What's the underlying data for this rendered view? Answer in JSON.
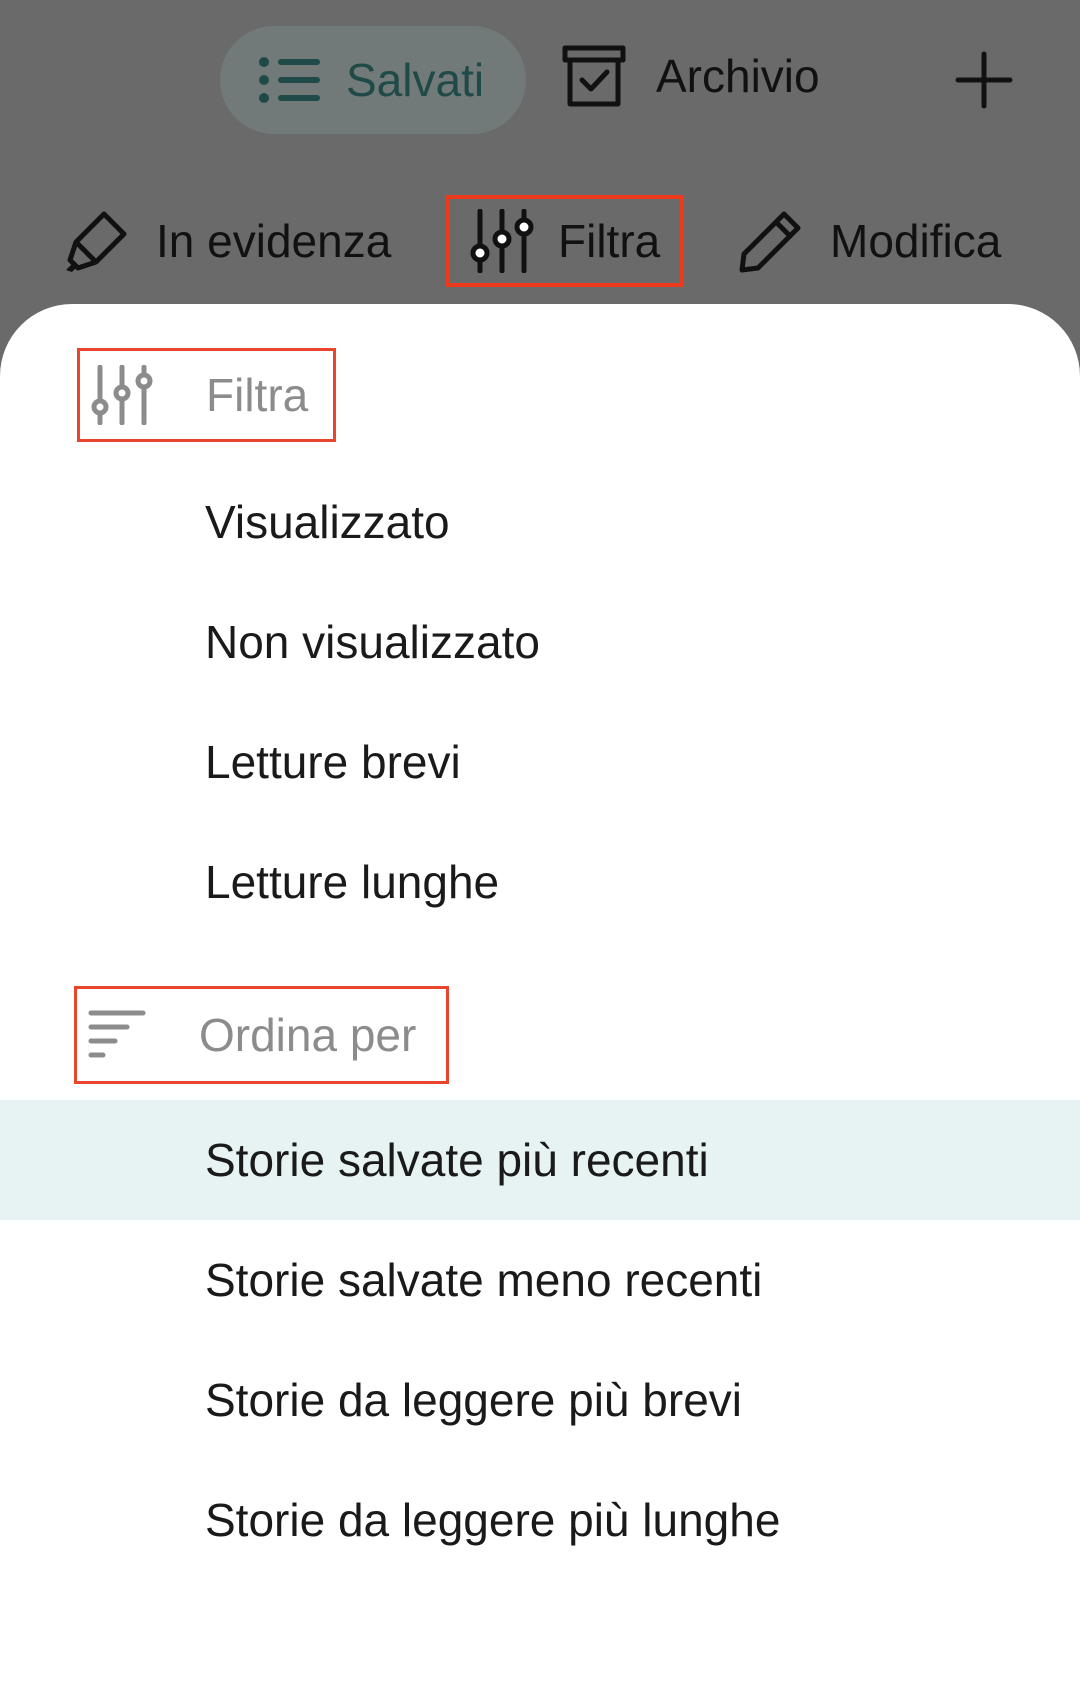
{
  "top_nav": {
    "saved_label": "Salvati",
    "archive_label": "Archivio"
  },
  "actions": {
    "highlights_label": "In evidenza",
    "filter_label": "Filtra",
    "edit_label": "Modifica"
  },
  "sheet": {
    "filter_section": {
      "label": "Filtra",
      "items": [
        "Visualizzato",
        "Non visualizzato",
        "Letture brevi",
        "Letture lunghe"
      ]
    },
    "sort_section": {
      "label": "Ordina per",
      "items": [
        "Storie salvate più recenti",
        "Storie salvate meno recenti",
        "Storie da leggere più brevi",
        "Storie da leggere più lunghe"
      ],
      "selected_index": 0
    }
  },
  "colors": {
    "overlay": "#6a6a6a",
    "highlight_box": "#ee3a1c",
    "selected_row": "#e6f3f2",
    "section_label": "#8c8c8c"
  }
}
